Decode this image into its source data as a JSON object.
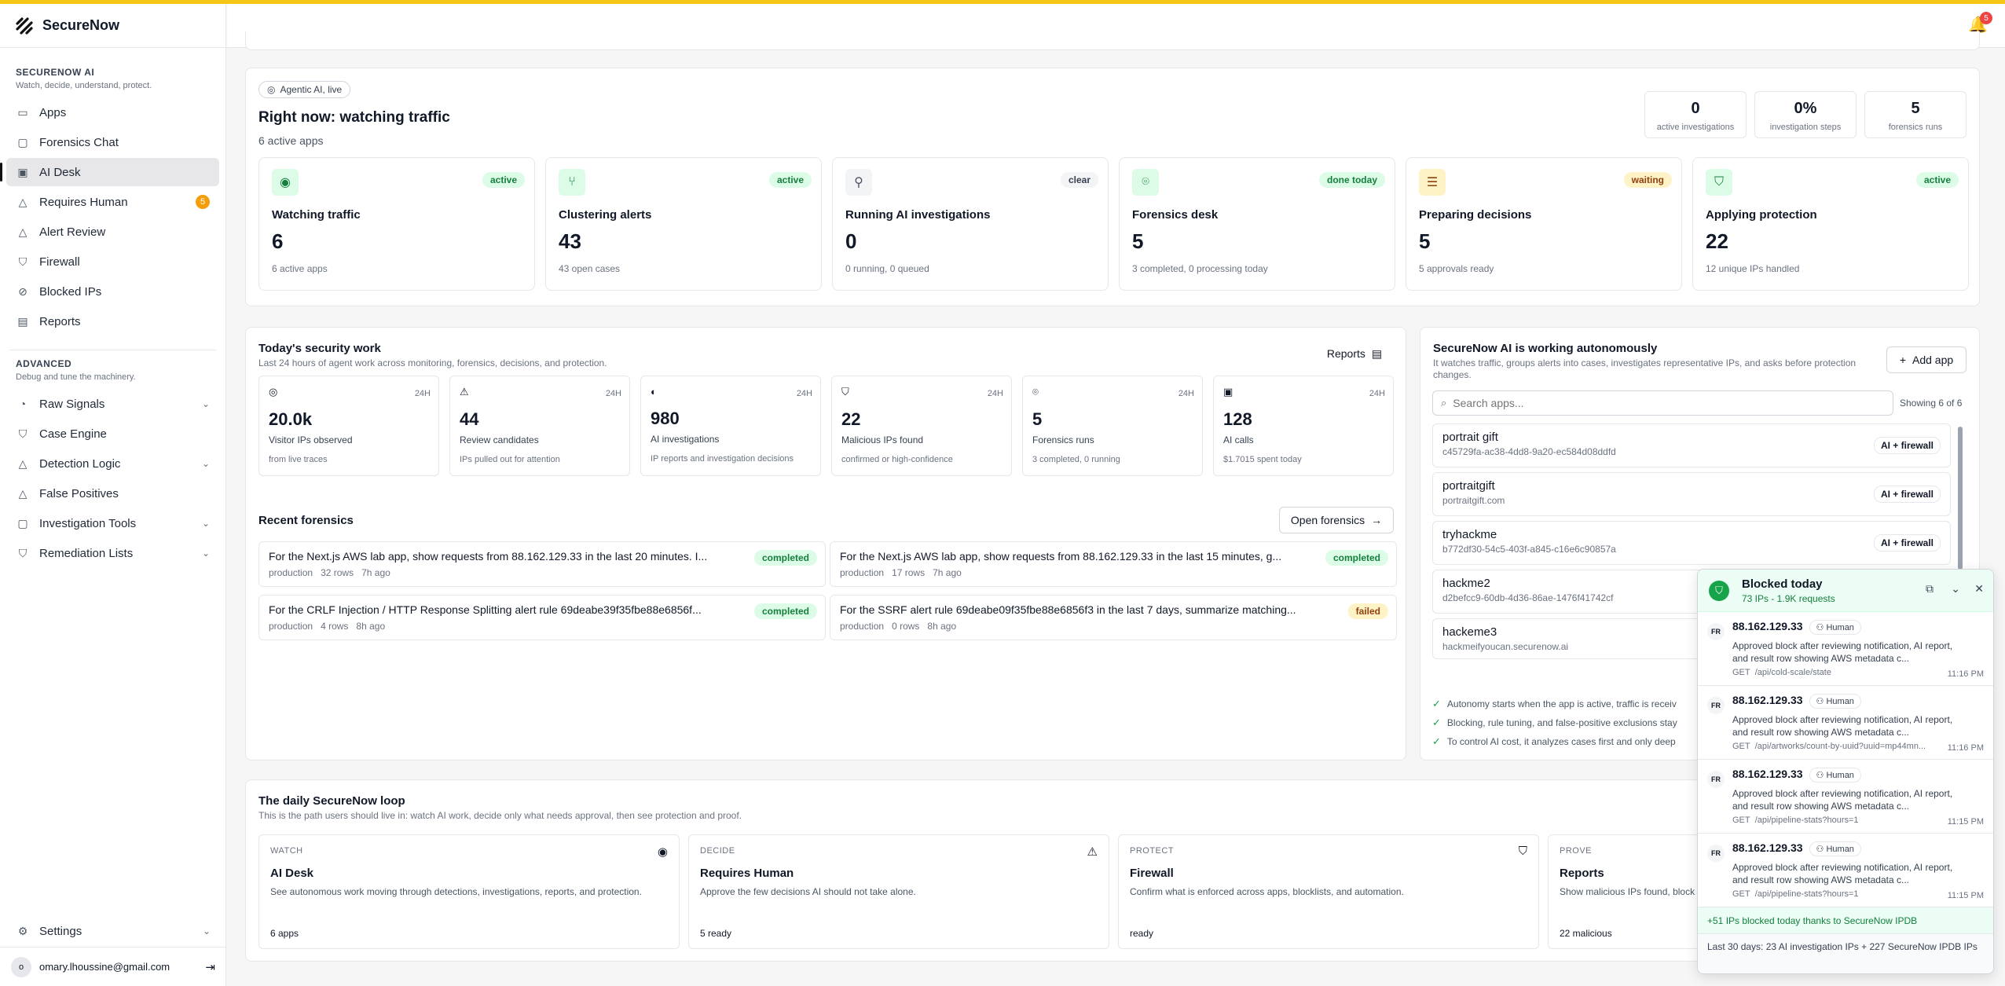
{
  "app": {
    "name": "SecureNow"
  },
  "header": {
    "notif_count": "5"
  },
  "sidebar": {
    "section1": {
      "title": "SECURENOW AI",
      "subtitle": "Watch, decide, understand, protect."
    },
    "items1": [
      {
        "label": "Apps"
      },
      {
        "label": "Forensics Chat"
      },
      {
        "label": "AI Desk"
      },
      {
        "label": "Requires Human",
        "badge": "5"
      },
      {
        "label": "Alert Review"
      },
      {
        "label": "Firewall"
      },
      {
        "label": "Blocked IPs"
      },
      {
        "label": "Reports"
      }
    ],
    "section2": {
      "title": "ADVANCED",
      "subtitle": "Debug and tune the machinery."
    },
    "items2": [
      {
        "label": "Raw Signals"
      },
      {
        "label": "Case Engine"
      },
      {
        "label": "Detection Logic"
      },
      {
        "label": "False Positives"
      },
      {
        "label": "Investigation Tools"
      },
      {
        "label": "Remediation Lists"
      }
    ],
    "settings": "Settings",
    "user": {
      "initial": "o",
      "email": "omary.lhoussine@gmail.com"
    }
  },
  "live": {
    "pill": "Agentic AI, live",
    "title": "Right now: watching traffic",
    "subtitle": "6 active apps",
    "stats": [
      {
        "value": "0",
        "label": "active investigations"
      },
      {
        "value": "0%",
        "label": "investigation steps"
      },
      {
        "value": "5",
        "label": "forensics runs"
      }
    ],
    "stages": [
      {
        "tag": "active",
        "title": "Watching traffic",
        "value": "6",
        "sub": "6 active apps"
      },
      {
        "tag": "active",
        "title": "Clustering alerts",
        "value": "43",
        "sub": "43 open cases"
      },
      {
        "tag": "clear",
        "title": "Running AI investigations",
        "value": "0",
        "sub": "0 running, 0 queued"
      },
      {
        "tag": "done today",
        "title": "Forensics desk",
        "value": "5",
        "sub": "3 completed, 0 processing today"
      },
      {
        "tag": "waiting",
        "title": "Preparing decisions",
        "value": "5",
        "sub": "5 approvals ready"
      },
      {
        "tag": "active",
        "title": "Applying protection",
        "value": "22",
        "sub": "12 unique IPs handled"
      }
    ]
  },
  "today": {
    "title": "Today's security work",
    "subtitle": "Last 24 hours of agent work across monitoring, forensics, decisions, and protection.",
    "reports_btn": "Reports",
    "metrics": [
      {
        "period": "24H",
        "value": "20.0k",
        "label": "Visitor IPs observed",
        "detail": "from live traces"
      },
      {
        "period": "24H",
        "value": "44",
        "label": "Review candidates",
        "detail": "IPs pulled out for attention"
      },
      {
        "period": "24H",
        "value": "980",
        "label": "AI investigations",
        "detail": "IP reports and investigation decisions"
      },
      {
        "period": "24H",
        "value": "22",
        "label": "Malicious IPs found",
        "detail": "confirmed or high-confidence"
      },
      {
        "period": "24H",
        "value": "5",
        "label": "Forensics runs",
        "detail": "3 completed, 0 running"
      },
      {
        "period": "24H",
        "value": "128",
        "label": "AI calls",
        "detail": "$1.7015 spent today"
      }
    ],
    "recent_title": "Recent forensics",
    "open_btn": "Open forensics",
    "forensics": [
      {
        "query": "For the Next.js AWS lab app, show requests from 88.162.129.33 in the last 20 minutes. I...",
        "env": "production",
        "rows": "32 rows",
        "time": "7h ago",
        "status": "completed"
      },
      {
        "query": "For the Next.js AWS lab app, show requests from 88.162.129.33 in the last 15 minutes, g...",
        "env": "production",
        "rows": "17 rows",
        "time": "7h ago",
        "status": "completed"
      },
      {
        "query": "For the CRLF Injection / HTTP Response Splitting alert rule 69deabe39f35fbe88e6856f...",
        "env": "production",
        "rows": "4 rows",
        "time": "8h ago",
        "status": "completed"
      },
      {
        "query": "For the SSRF alert rule 69deabe09f35fbe88e6856f3 in the last 7 days, summarize matching...",
        "env": "production",
        "rows": "0 rows",
        "time": "8h ago",
        "status": "failed"
      }
    ]
  },
  "autonomous": {
    "title": "SecureNow AI is working autonomously",
    "subtitle": "It watches traffic, groups alerts into cases, investigates representative IPs, and asks before protection changes.",
    "add_btn": "Add app",
    "search_placeholder": "Search apps...",
    "showing": "Showing 6 of 6",
    "apps": [
      {
        "name": "portrait gift",
        "id": "c45729fa-ac38-4dd8-9a20-ec584d08ddfd",
        "badge": "AI + firewall"
      },
      {
        "name": "portraitgift",
        "id": "portraitgift.com",
        "badge": "AI + firewall"
      },
      {
        "name": "tryhackme",
        "id": "b772df30-54c5-403f-a845-c16e6c90857a",
        "badge": "AI + firewall"
      },
      {
        "name": "hackme2",
        "id": "d2befcc9-60db-4d36-86ae-1476f41742cf",
        "badge": ""
      },
      {
        "name": "hackeme3",
        "id": "hackmeifyoucan.securenow.ai",
        "badge": ""
      }
    ],
    "notes": [
      "Autonomy starts when the app is active, traffic is receiv",
      "Blocking, rule tuning, and false-positive exclusions stay",
      "To control AI cost, it analyzes cases first and only deep"
    ]
  },
  "loop": {
    "title": "The daily SecureNow loop",
    "subtitle": "This is the path users should live in: watch AI work, decide only what needs approval, then see protection and proof.",
    "cards": [
      {
        "kicker": "WATCH",
        "title": "AI Desk",
        "desc": "See autonomous work moving through detections, investigations, reports, and protection.",
        "foot": "6 apps"
      },
      {
        "kicker": "DECIDE",
        "title": "Requires Human",
        "desc": "Approve the few decisions AI should not take alone.",
        "foot": "5 ready"
      },
      {
        "kicker": "PROTECT",
        "title": "Firewall",
        "desc": "Confirm what is enforced across apps, blocklists, and automation.",
        "foot": "ready"
      },
      {
        "kicker": "PROVE",
        "title": "Reports",
        "desc": "Show malicious IPs found, block",
        "foot": "22 malicious"
      }
    ]
  },
  "blocked": {
    "title": "Blocked today",
    "subtitle": "73 IPs - 1.9K requests",
    "entries": [
      {
        "cc": "FR",
        "ip": "88.162.129.33",
        "by": "Human",
        "reason": "Approved block after reviewing notification, AI report, and result row showing AWS metadata c...",
        "method": "GET",
        "path": "/api/cold-scale/state",
        "time": "11:16 PM"
      },
      {
        "cc": "FR",
        "ip": "88.162.129.33",
        "by": "Human",
        "reason": "Approved block after reviewing notification, AI report, and result row showing AWS metadata c...",
        "method": "GET",
        "path": "/api/artworks/count-by-uuid?uuid=mp44mn...",
        "time": "11:16 PM"
      },
      {
        "cc": "FR",
        "ip": "88.162.129.33",
        "by": "Human",
        "reason": "Approved block after reviewing notification, AI report, and result row showing AWS metadata c...",
        "method": "GET",
        "path": "/api/pipeline-stats?hours=1",
        "time": "11:15 PM"
      },
      {
        "cc": "FR",
        "ip": "88.162.129.33",
        "by": "Human",
        "reason": "Approved block after reviewing notification, AI report, and result row showing AWS metadata c...",
        "method": "GET",
        "path": "/api/pipeline-stats?hours=1",
        "time": "11:15 PM"
      }
    ],
    "footer1": "+51 IPs blocked today thanks to SecureNow IPDB",
    "footer2": "Last 30 days: 23 AI investigation IPs + 227 SecureNow IPDB IPs"
  }
}
